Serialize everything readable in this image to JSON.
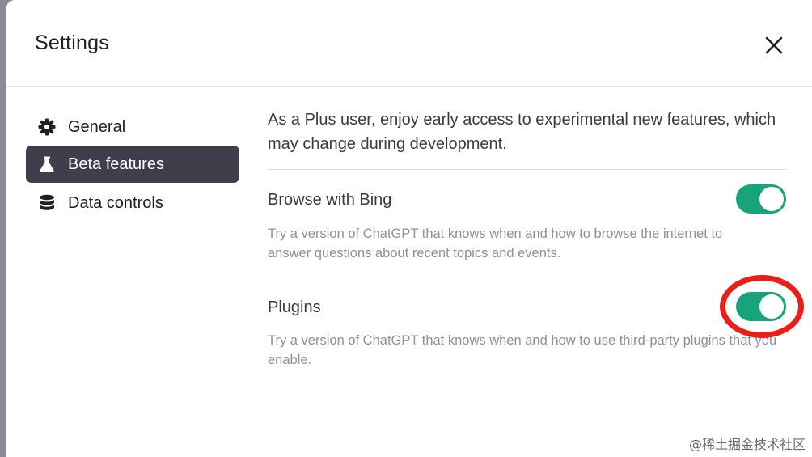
{
  "dialog": {
    "title": "Settings",
    "close_icon": "close-icon"
  },
  "sidebar": {
    "items": [
      {
        "label": "General",
        "icon": "gear-icon",
        "active": false
      },
      {
        "label": "Beta features",
        "icon": "flask-icon",
        "active": true
      },
      {
        "label": "Data controls",
        "icon": "database-icon",
        "active": false
      }
    ]
  },
  "main": {
    "intro": "As a Plus user, enjoy early access to experimental new features, which may change during development.",
    "features": [
      {
        "title": "Browse with Bing",
        "description": "Try a version of ChatGPT that knows when and how to browse the internet to answer questions about recent topics and events.",
        "enabled": true
      },
      {
        "title": "Plugins",
        "description": "Try a version of ChatGPT that knows when and how to use third-party plugins that you enable.",
        "enabled": true
      }
    ]
  },
  "watermark": "@稀土掘金技术社区",
  "colors": {
    "toggle_on": "#19a37a",
    "active_nav": "#3e3f4b",
    "annotation": "#ea1f1a"
  }
}
